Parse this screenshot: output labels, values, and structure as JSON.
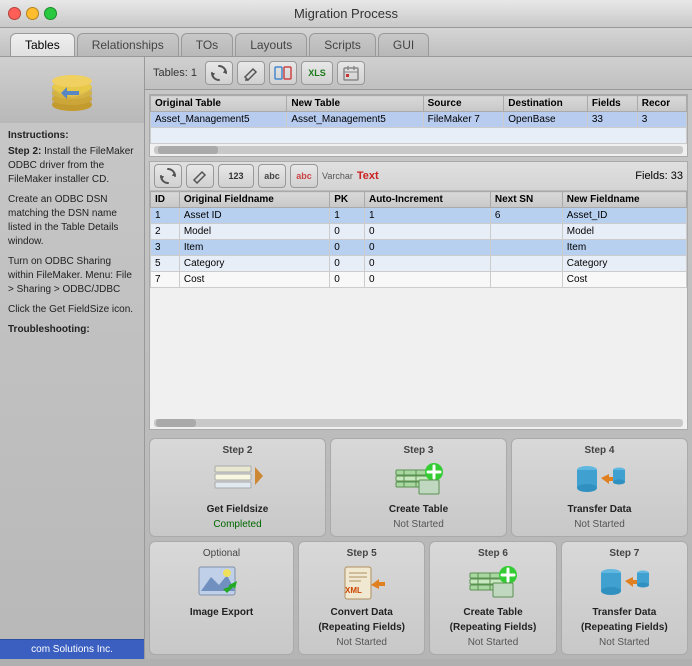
{
  "title": "Migration Process",
  "tabs": [
    {
      "label": "Tables",
      "active": true
    },
    {
      "label": "Relationships",
      "active": false
    },
    {
      "label": "TOs",
      "active": false
    },
    {
      "label": "Layouts",
      "active": false
    },
    {
      "label": "Scripts",
      "active": false
    },
    {
      "label": "GUI",
      "active": false
    }
  ],
  "toolbar": {
    "tables_label": "Tables:",
    "tables_count": "1"
  },
  "tables": {
    "columns": [
      "Original Table",
      "New Table",
      "Source",
      "Destination",
      "Fields",
      "Recor"
    ],
    "rows": [
      [
        "Asset_Management5",
        "Asset_Management5",
        "FileMaker 7",
        "OpenBase",
        "33",
        "3"
      ]
    ]
  },
  "fields": {
    "label": "Fields:",
    "count": "33",
    "columns": [
      "ID",
      "Original Fieldname",
      "PK",
      "Auto-Increment",
      "Next SN",
      "New Fieldname"
    ],
    "rows": [
      {
        "id": "1",
        "name": "Asset ID",
        "pk": "1",
        "auto": "1",
        "nextsn": "6",
        "newname": "Asset_ID",
        "highlight": true
      },
      {
        "id": "2",
        "name": "Model",
        "pk": "0",
        "auto": "0",
        "nextsn": "",
        "newname": "Model",
        "highlight": false
      },
      {
        "id": "3",
        "name": "Item",
        "pk": "0",
        "auto": "0",
        "nextsn": "",
        "newname": "Item",
        "highlight": true
      },
      {
        "id": "5",
        "name": "Category",
        "pk": "0",
        "auto": "0",
        "nextsn": "",
        "newname": "Category",
        "highlight": false
      },
      {
        "id": "7",
        "name": "Cost",
        "pk": "0",
        "auto": "0",
        "nextsn": "",
        "newname": "Cost",
        "highlight": false
      }
    ]
  },
  "steps": [
    {
      "number": "Step 2",
      "name": "Get Fieldsize",
      "status": "Completed",
      "status_type": "completed",
      "icon_type": "fieldsize"
    },
    {
      "number": "Step 3",
      "name": "Create Table",
      "status": "Not Started",
      "status_type": "not-started",
      "icon_type": "create-table"
    },
    {
      "number": "Step 4",
      "name": "Transfer Data",
      "status": "Not Started",
      "status_type": "not-started",
      "icon_type": "transfer-data"
    }
  ],
  "bottom_optional": {
    "label": "Optional",
    "name": "Image Export"
  },
  "bottom_steps": [
    {
      "number": "Step 5",
      "name": "Convert Data\n(Repeating Fields)",
      "name_line1": "Convert Data",
      "name_line2": "(Repeating Fields)",
      "status": "Not Started",
      "status_type": "not-started",
      "icon_type": "convert-data"
    },
    {
      "number": "Step 6",
      "name_line1": "Create Table",
      "name_line2": "(Repeating Fields)",
      "status": "Not Started",
      "status_type": "not-started",
      "icon_type": "create-table"
    },
    {
      "number": "Step 7",
      "name_line1": "Transfer Data",
      "name_line2": "(Repeating Fields)",
      "status": "Not Started",
      "status_type": "not-started",
      "icon_type": "transfer-data"
    }
  ],
  "sidebar": {
    "instructions_title": "Instructions:",
    "step2_title": "Step 2:",
    "step2_text1": "Install the FileMaker ODBC driver from the FileMaker installer CD.",
    "step2_text2": "Create an ODBC DSN matching the DSN name listed in the Table Details window.",
    "step2_text3": "Turn on ODBC Sharing within FileMaker. Menu: File > Sharing > ODBC/JDBC",
    "step2_text4": "Click the Get FieldSize icon.",
    "troubleshooting": "Troubleshooting:",
    "bottom_label": "com Solutions Inc."
  }
}
